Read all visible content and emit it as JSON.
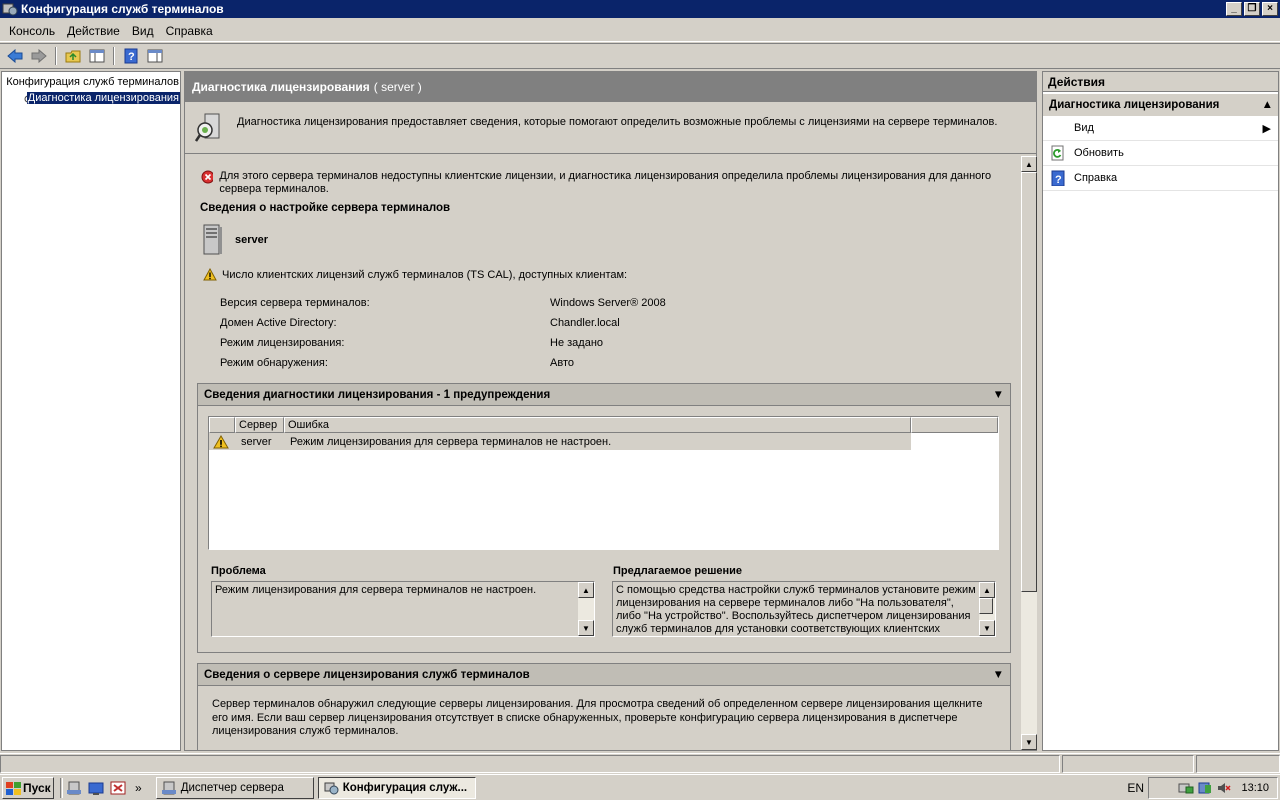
{
  "window": {
    "title": "Конфигурация служб терминалов"
  },
  "menu": [
    "Консоль",
    "Действие",
    "Вид",
    "Справка"
  ],
  "tree": {
    "root": "Конфигурация служб терминалов",
    "child": "Диагностика лицензирования"
  },
  "center": {
    "header_title": "Диагностика лицензирования",
    "header_sub": "( server )",
    "description": "Диагностика лицензирования предоставляет сведения, которые помогают определить возможные проблемы с лицензиями на сервере терминалов.",
    "error_message": "Для этого сервера терминалов недоступны клиентские лицензии, и диагностика лицензирования определила проблемы лицензирования для данного сервера терминалов.",
    "config_heading": "Сведения о настройке сервера терминалов",
    "server_name": "server",
    "cal_warning": "Число клиентских лицензий служб терминалов (TS CAL), доступных клиентам:",
    "props": [
      {
        "key": "Версия сервера терминалов:",
        "value": "Windows Server® 2008"
      },
      {
        "key": "Домен Active Directory:",
        "value": "Chandler.local"
      },
      {
        "key": "Режим лицензирования:",
        "value": "Не задано"
      },
      {
        "key": "Режим обнаружения:",
        "value": "Авто"
      }
    ],
    "diag_group": {
      "title": "Сведения диагностики лицензирования - 1 предупреждения",
      "columns": [
        "Сервер",
        "Ошибка"
      ],
      "rows": [
        {
          "server": "server",
          "error": "Режим лицензирования для сервера терминалов не настроен."
        }
      ],
      "problem_label": "Проблема",
      "problem_text": "Режим лицензирования для сервера терминалов не настроен.",
      "solution_label": "Предлагаемое решение",
      "solution_text": "С помощью средства настройки служб терминалов установите режим лицензирования на сервере терминалов либо \"На пользователя\", либо \"На устройство\". Воспользуйтесь диспетчером лицензирования служб терминалов для установки соответствующих клиентских"
    },
    "ls_group": {
      "title": "Сведения о сервере лицензирования служб терминалов",
      "text": "Сервер терминалов обнаружил следующие серверы лицензирования. Для просмотра сведений об определенном сервере лицензирования щелкните его имя.  Если ваш сервер лицензирования отсутствует в списке обнаруженных, проверьте конфигурацию сервера лицензирования в диспетчере лицензирования служб терминалов."
    }
  },
  "actions": {
    "header": "Действия",
    "section": "Диагностика лицензирования",
    "items": [
      "Вид",
      "Обновить",
      "Справка"
    ]
  },
  "taskbar": {
    "start": "Пуск",
    "tasks": [
      "Диспетчер сервера",
      "Конфигурация служ..."
    ],
    "lang": "EN",
    "clock": "13:10"
  },
  "colors": {
    "titlebar": "#0a246a",
    "selection": "#0a246a",
    "header_gray": "#808080",
    "face": "#d4d0c8"
  }
}
